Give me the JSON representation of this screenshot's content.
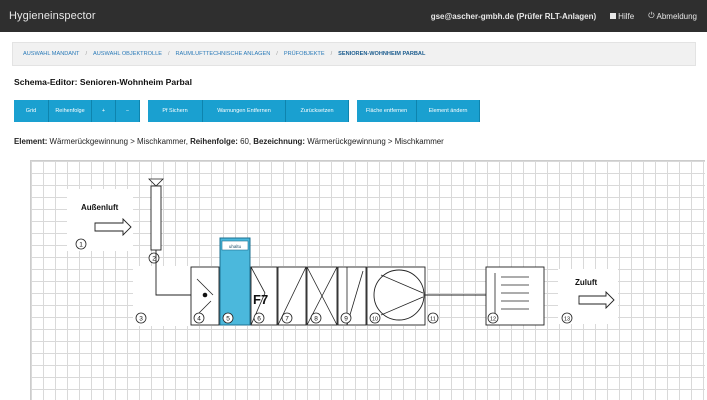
{
  "app": {
    "title": "Hygieneinspector"
  },
  "header": {
    "user": "gse@ascher-gmbh.de (Prüfer RLT-Anlagen)",
    "help_label": "Hilfe",
    "logout_label": "Abmeldung"
  },
  "breadcrumb": [
    "Auswahl Mandant",
    "Auswahl Objektrolle",
    "Raumlufttechnische Anlagen",
    "Prüfobjekte",
    "Senioren-Wohnheim Parbal"
  ],
  "page": {
    "title": "Schema-Editor: Senioren-Wohnheim Parbal"
  },
  "toolbar": {
    "buttons": [
      "Grid",
      "Reihenfolge",
      "+",
      "−",
      "Pf Sichern",
      "Warnungen Entfernen",
      "Zurücksetzen",
      "Fläche entfernen",
      "Element ändern"
    ]
  },
  "element_info": {
    "element_label": "Element:",
    "element_value": "Wärmerückgewinnung > Mischkammer,",
    "order_label": "Reihenfolge:",
    "order_value": "60,",
    "name_label": "Bezeichnung:",
    "name_value": "Wärmerückgewinnung > Mischkammer"
  },
  "schema": {
    "outside_air_label": "Außenluft",
    "supply_air_label": "Zuluft",
    "filter_class": "F7",
    "numbers": [
      "1",
      "2",
      "3",
      "4",
      "5",
      "6",
      "7",
      "8",
      "9",
      "10",
      "11",
      "12",
      "13"
    ],
    "highlight_color": "#4bb8dc",
    "highlight_tag": "uhaltu"
  }
}
